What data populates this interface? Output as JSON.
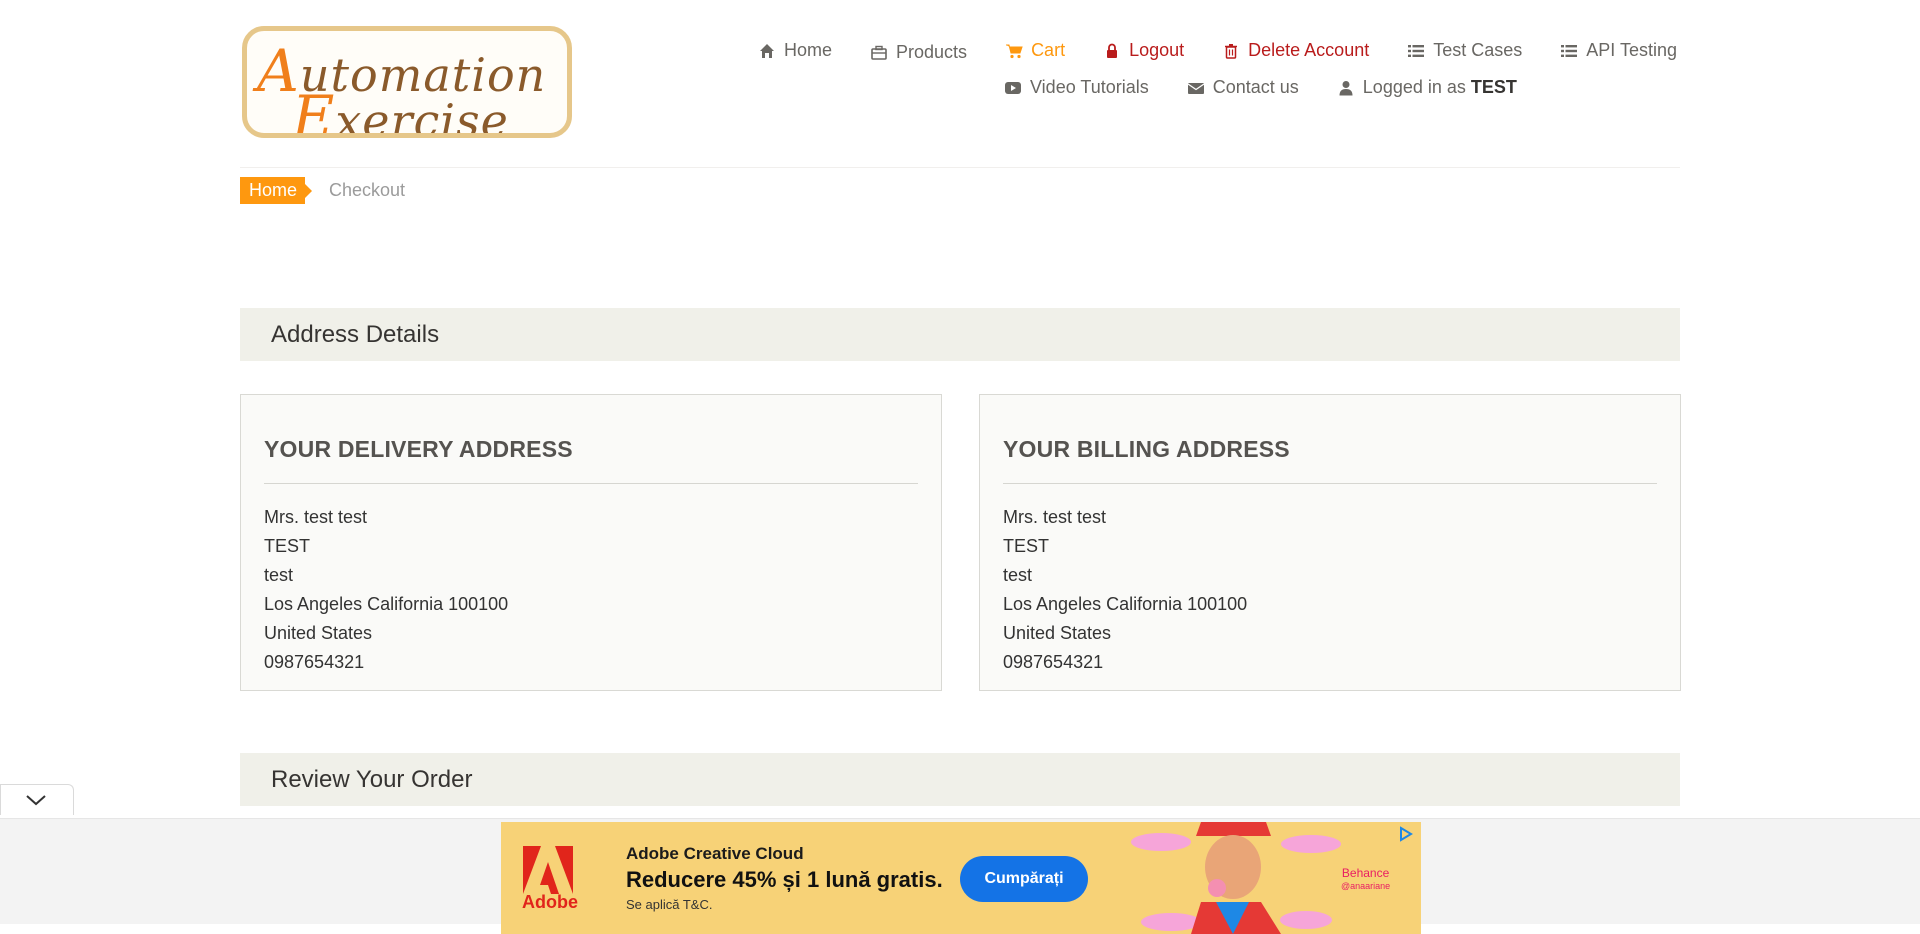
{
  "logo": {
    "line1_cap": "A",
    "line1_rest": "utomation",
    "line2_cap": "E",
    "line2_rest": "xercise"
  },
  "nav": {
    "row1": [
      {
        "label": "Home",
        "icon": "home-icon"
      },
      {
        "label": "Products",
        "icon": "products-icon"
      },
      {
        "label": "Cart",
        "icon": "cart-icon"
      },
      {
        "label": "Logout",
        "icon": "lock-icon"
      },
      {
        "label": "Delete Account",
        "icon": "trash-icon"
      },
      {
        "label": "Test Cases",
        "icon": "list-icon"
      },
      {
        "label": "API Testing",
        "icon": "list-icon"
      }
    ],
    "row2": [
      {
        "label": "Video Tutorials",
        "icon": "youtube-icon"
      },
      {
        "label": "Contact us",
        "icon": "envelope-icon"
      },
      {
        "label": "Logged in as",
        "icon": "user-icon",
        "user": "TEST"
      }
    ]
  },
  "breadcrumb": {
    "home": "Home",
    "current": "Checkout"
  },
  "address_section": {
    "title": "Address Details"
  },
  "delivery": {
    "title": "YOUR DELIVERY ADDRESS",
    "lines": [
      "Mrs. test test",
      "TEST",
      "test",
      "Los Angeles California 100100",
      "United States",
      "0987654321"
    ]
  },
  "billing": {
    "title": "YOUR BILLING ADDRESS",
    "lines": [
      "Mrs. test test",
      "TEST",
      "test",
      "Los Angeles California 100100",
      "United States",
      "0987654321"
    ]
  },
  "review_section": {
    "title": "Review Your Order"
  },
  "ad": {
    "brand": "Adobe",
    "headline": "Adobe Creative Cloud",
    "main": "Reducere 45% și 1 lună gratis.",
    "sub": "Se aplică T&C.",
    "cta": "Cumpărați",
    "behance_line1": "Behance",
    "behance_line2": "@anaariane"
  },
  "colors": {
    "accent": "#fe980f",
    "danger": "#b91c1c",
    "section_bg": "#f0f0e9",
    "ad_bg": "#f7d277",
    "ad_cta": "#1473e6"
  }
}
